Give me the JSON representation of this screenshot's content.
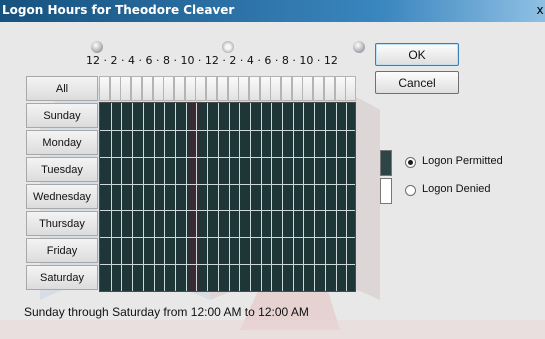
{
  "window": {
    "title": "Logon Hours for Theodore Cleaver",
    "close_glyph": "x"
  },
  "schedule": {
    "time_labels": "12 · 2 · 4 · 6 · 8 · 10 · 12 · 2 · 4 · 6 · 8 · 10 · 12",
    "all_label": "All",
    "days": [
      "Sunday",
      "Monday",
      "Tuesday",
      "Wednesday",
      "Thursday",
      "Friday",
      "Saturday"
    ],
    "status_text": "Sunday through Saturday from 12:00 AM to 12:00 AM"
  },
  "buttons": {
    "ok": "OK",
    "cancel": "Cancel"
  },
  "legend": {
    "permitted": "Logon Permitted",
    "denied": "Logon Denied",
    "selected": "permitted"
  },
  "icons": {
    "midnight": "moon-icon",
    "noon": "sun-icon"
  },
  "colors": {
    "title_bar": "#1b5a8a",
    "grid_permitted": "#1e3638",
    "grid_lines": "#cfd8d8"
  }
}
